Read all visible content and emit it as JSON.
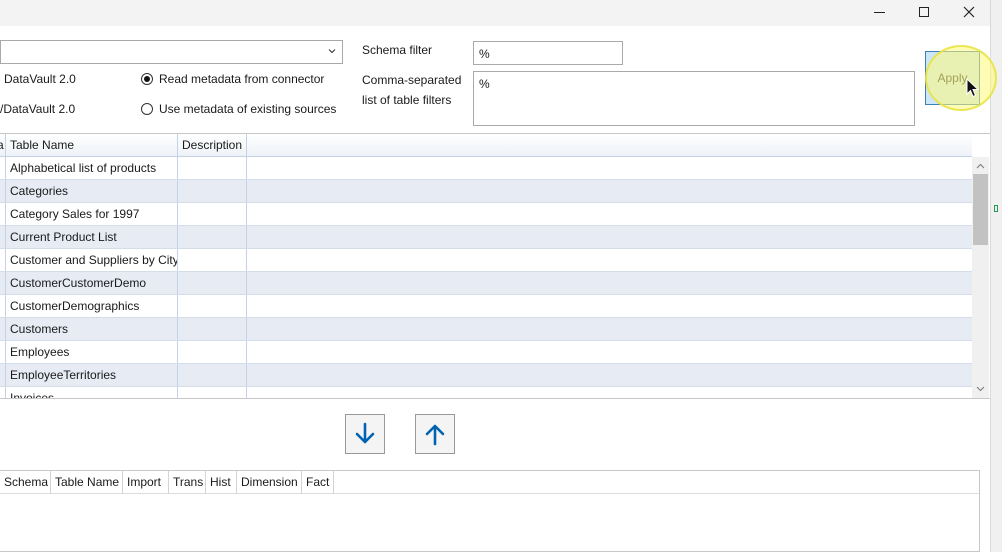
{
  "window": {
    "minimize_label": "—",
    "maximize_label": "",
    "close_label": ""
  },
  "source": {
    "selected_value": "",
    "target_label_1": "DataVault 2.0",
    "target_label_2": "/DataVault 2.0"
  },
  "metadata_mode": {
    "options": [
      {
        "label": "Read metadata from connector",
        "selected": true
      },
      {
        "label": "Use metadata of existing sources",
        "selected": false
      }
    ]
  },
  "filters": {
    "schema_filter_label": "Schema filter",
    "schema_filter_value": "%",
    "table_filters_label_line1": "Comma-separated",
    "table_filters_label_line2": "list of table filters",
    "table_filters_value": "%",
    "apply_label": "Apply"
  },
  "available_tables": {
    "columns": [
      "a",
      "Table Name",
      "Description"
    ],
    "rows": [
      {
        "name": "Alphabetical list of products",
        "description": ""
      },
      {
        "name": "Categories",
        "description": ""
      },
      {
        "name": "Category Sales for 1997",
        "description": ""
      },
      {
        "name": "Current Product List",
        "description": ""
      },
      {
        "name": "Customer and Suppliers by City",
        "description": ""
      },
      {
        "name": "CustomerCustomerDemo",
        "description": ""
      },
      {
        "name": "CustomerDemographics",
        "description": ""
      },
      {
        "name": "Customers",
        "description": ""
      },
      {
        "name": "Employees",
        "description": ""
      },
      {
        "name": "EmployeeTerritories",
        "description": ""
      },
      {
        "name": "Invoices",
        "description": ""
      }
    ]
  },
  "move_buttons": {
    "down_icon": "arrow-down-icon",
    "up_icon": "arrow-up-icon"
  },
  "selected_tables": {
    "columns": [
      "Schema",
      "Table Name",
      "Import",
      "Trans",
      "Hist",
      "Dimension",
      "Fact"
    ]
  },
  "colors": {
    "accent": "#0063b1",
    "apply_bg": "#cde6f7",
    "row_alt": "#e6ebf4"
  }
}
